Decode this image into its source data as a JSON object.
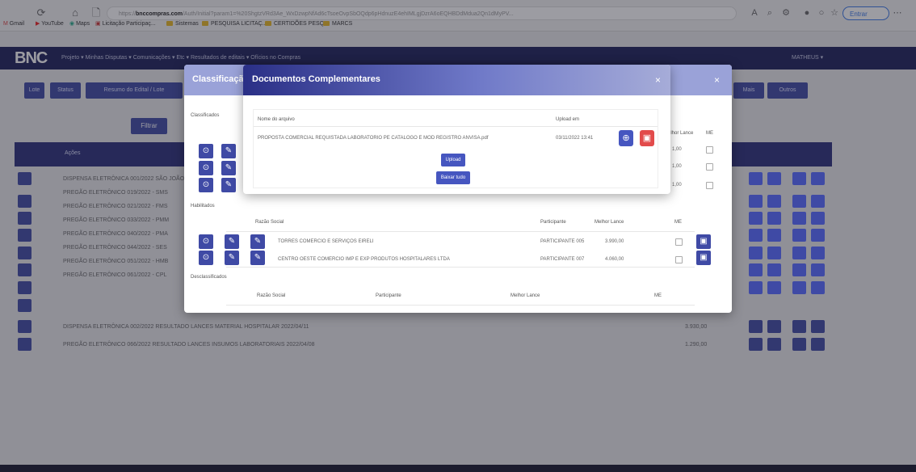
{
  "browser": {
    "url_prefix": "https://",
    "url_domain": "bnccompras.com",
    "url_rest": "/Auth/Initial?param1=%20ShgtzVRd3Ae_WxDzwpNfAd6cTsoeOvpSbOQdp6pHdnuzE4ehIMLgjDzrA6oEQHBDdMdua2Qn1dMyPV..."
  },
  "bookmarks": [
    "Gmail",
    "YouTube",
    "Maps",
    "Licitação Participaç...",
    "Sistemas",
    "PESQUISA LICITAÇ...",
    "CERTIDÕES PESQ",
    "MARCS"
  ],
  "profile": {
    "entrar_label": "Entrar"
  },
  "app": {
    "logo": "BNC",
    "nav_links": "Projeto ▾   Minhas Disputas ▾   Comunicações ▾   Etc ▾   Resultados de editais ▾   Ofícios no Compras",
    "user": "MATHEUS ▾",
    "sub_buttons": [
      "Lote",
      "Status",
      "Resumo do Edital / Lote",
      "Mais",
      "Outros"
    ],
    "filter_btn": "Filtrar",
    "table_header": "Ações",
    "rows": [
      "DISPENSA ELETRÔNICA 001/2022 SÃO JOÃO",
      "PREGÃO ELETRÔNICO 019/2022 - SMS",
      "PREGÃO ELETRÔNICO 021/2022 - FMS",
      "PREGÃO ELETRÔNICO 033/2022 - PMM",
      "PREGÃO ELETRÔNICO 040/2022 - PMA",
      "PREGÃO ELETRÔNICO 044/2022 - SES",
      "PREGÃO ELETRÔNICO 051/2022 - HMB",
      "PREGÃO ELETRÔNICO 061/2022 - CPL",
      "DISPENSA ELETRÔNICA 002/2022   RESULTADO LANCES   MATERIAL HOSPITALAR 2022/04/11",
      "PREGÃO ELETRÔNICO 066/2022   RESULTADO LANCES   INSUMOS LABORATORIAIS 2022/04/08"
    ],
    "row_values": [
      "",
      "",
      "",
      "",
      "",
      "",
      "",
      "",
      "3.930,00",
      "1.290,00"
    ]
  },
  "modal_classificacao": {
    "title": "Classificação",
    "section_classificados": "Classificados",
    "section_habilitados": "Habilitados",
    "section_desclassificados": "Desclassificados",
    "cols": {
      "razao": "Razão Social",
      "participante": "Participante",
      "melhor_lance": "Melhor Lance",
      "me": "ME"
    },
    "classificados_values": [
      "1,00",
      "1,00",
      "1,00"
    ],
    "habilitados": [
      {
        "razao": "TORRES COMERCIO E SERVIÇOS EIRELI",
        "participante": "PARTICIPANTE 005",
        "lance": "3.990,00"
      },
      {
        "razao": "CENTRO OESTE COMERCIO IMP E EXP PRODUTOS HOSPITALARES LTDA",
        "participante": "PARTICIPANTE 007",
        "lance": "4.060,00"
      }
    ]
  },
  "modal_documentos": {
    "title": "Documentos Complementares",
    "close": "×",
    "col_nome": "Nome do arquivo",
    "col_upload": "Upload em",
    "file_name": "PROPOSTA COMERCIAL REQUISTADA LABORATORIO PE CATALOGO E MOD REGISTRO ANVISA.pdf",
    "upload_date": "03/11/2022 13:41",
    "upload_btn": "Upload",
    "download_all_btn": "Baixar tudo"
  },
  "colors": {
    "nav": "#1d1f5a",
    "accent": "#3f4aa5",
    "danger": "#e24b4b"
  }
}
